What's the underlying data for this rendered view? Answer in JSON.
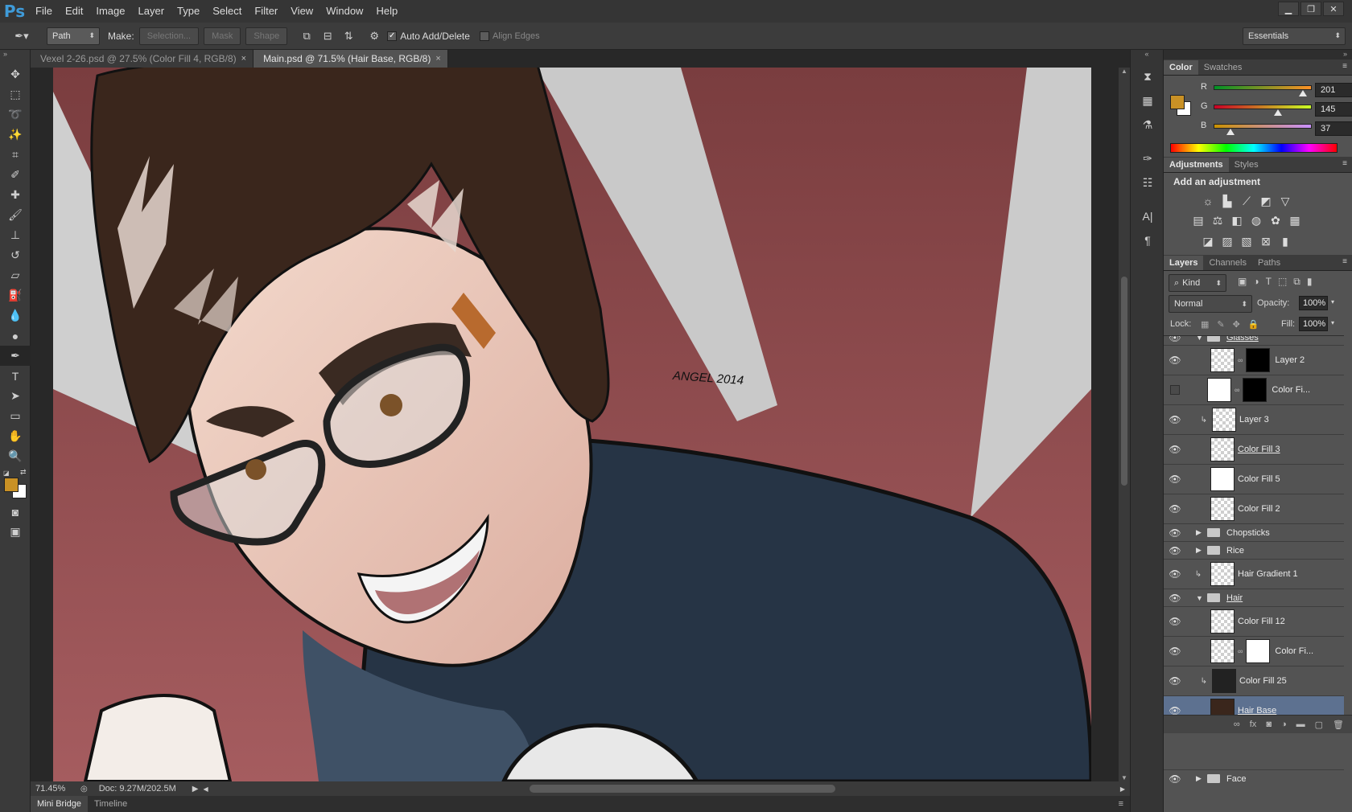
{
  "menubar": {
    "logo": "Ps",
    "items": [
      "File",
      "Edit",
      "Image",
      "Layer",
      "Type",
      "Select",
      "Filter",
      "View",
      "Window",
      "Help"
    ]
  },
  "options": {
    "mode": "Path",
    "make_label": "Make:",
    "selection": "Selection...",
    "mask": "Mask",
    "shape": "Shape",
    "auto_add_delete": "Auto Add/Delete",
    "align_edges": "Align Edges",
    "workspace": "Essentials"
  },
  "tabs": [
    {
      "label": "Vexel 2-26.psd @ 27.5% (Color Fill 4, RGB/8)",
      "close": "×"
    },
    {
      "label": "Main.psd @ 71.5% (Hair Base, RGB/8)",
      "close": "×"
    }
  ],
  "artwork": {
    "signature": "ANGEL 2014"
  },
  "status": {
    "zoom": "71.45%",
    "doc": "Doc: 9.27M/202.5M"
  },
  "bottom_tabs": [
    "Mini Bridge",
    "Timeline"
  ],
  "color_panel": {
    "tabs": [
      "Color",
      "Swatches"
    ],
    "channels": [
      {
        "label": "R",
        "value": "201",
        "level": 0.79
      },
      {
        "label": "G",
        "value": "145",
        "level": 0.57
      },
      {
        "label": "B",
        "value": "37",
        "level": 0.15
      }
    ],
    "fg_color": "#c99125"
  },
  "adjustments": {
    "tabs": [
      "Adjustments",
      "Styles"
    ],
    "title": "Add an adjustment"
  },
  "layers_panel": {
    "tabs": [
      "Layers",
      "Channels",
      "Paths"
    ],
    "kind": "Kind",
    "blend": "Normal",
    "opacity_label": "Opacity:",
    "opacity": "100%",
    "lock_label": "Lock:",
    "fill_label": "Fill:",
    "fill": "100%",
    "layers": [
      {
        "name": "Glasses",
        "type": "group"
      },
      {
        "name": "Layer 2",
        "type": "mask"
      },
      {
        "name": "Color Fi...",
        "type": "mask"
      },
      {
        "name": "Layer 3",
        "type": "clip"
      },
      {
        "name": "Color Fill 3",
        "type": "layer"
      },
      {
        "name": "Color Fill 5",
        "type": "layer"
      },
      {
        "name": "Color Fill 2",
        "type": "layer"
      },
      {
        "name": "Chopsticks",
        "type": "group"
      },
      {
        "name": "Rice",
        "type": "group"
      },
      {
        "name": "Hair Gradient 1",
        "type": "layer"
      },
      {
        "name": "Hair",
        "type": "group"
      },
      {
        "name": "Color Fill 12",
        "type": "layer"
      },
      {
        "name": "Color Fi...",
        "type": "mask"
      },
      {
        "name": "Color Fill 25",
        "type": "clip"
      },
      {
        "name": "Hair Base",
        "type": "layer"
      },
      {
        "name": "Face",
        "type": "group"
      }
    ]
  }
}
